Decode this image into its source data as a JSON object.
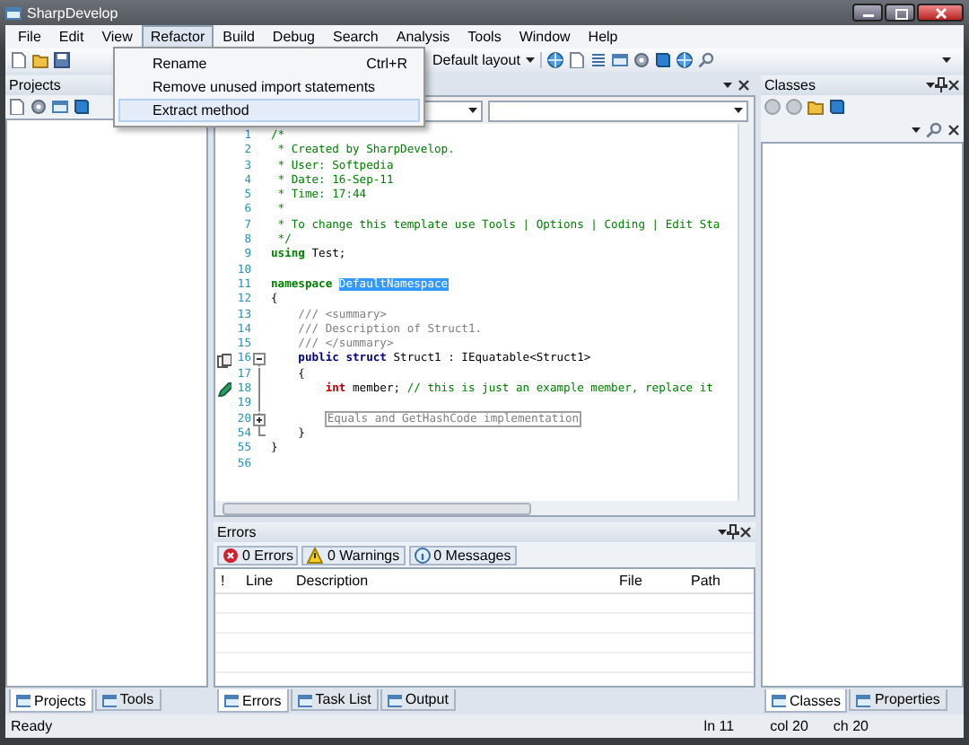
{
  "window": {
    "title": "SharpDevelop"
  },
  "menu": [
    {
      "label": "File",
      "selected": false
    },
    {
      "label": "Edit",
      "selected": false
    },
    {
      "label": "View",
      "selected": false
    },
    {
      "label": "Refactor",
      "selected": true
    },
    {
      "label": "Build",
      "selected": false
    },
    {
      "label": "Debug",
      "selected": false
    },
    {
      "label": "Search",
      "selected": false
    },
    {
      "label": "Analysis",
      "selected": false
    },
    {
      "label": "Tools",
      "selected": false
    },
    {
      "label": "Window",
      "selected": false
    },
    {
      "label": "Help",
      "selected": false
    }
  ],
  "dropdown": [
    {
      "label": "Rename",
      "shortcut": "Ctrl+R",
      "highlighted": false
    },
    {
      "label": "Remove unused import statements",
      "highlighted": false
    },
    {
      "label": "Extract method",
      "highlighted": true
    }
  ],
  "toolbar": {
    "layout": "Default layout"
  },
  "projects": {
    "title": "Projects",
    "tabs": [
      {
        "label": "Projects",
        "selected": true
      },
      {
        "label": "Tools",
        "selected": false
      }
    ]
  },
  "editor": {
    "lines": [
      {
        "number": "1",
        "segments": [
          {
            "kind": "comment",
            "text": "/*"
          }
        ]
      },
      {
        "number": "2",
        "segments": [
          {
            "kind": "comment",
            "text": " * Created by SharpDevelop."
          }
        ]
      },
      {
        "number": "3",
        "segments": [
          {
            "kind": "comment",
            "text": " * User: Softpedia"
          }
        ]
      },
      {
        "number": "4",
        "segments": [
          {
            "kind": "comment",
            "text": " * Date: 16-Sep-11"
          }
        ]
      },
      {
        "number": "5",
        "segments": [
          {
            "kind": "comment",
            "text": " * Time: 17:44"
          }
        ]
      },
      {
        "number": "6",
        "segments": [
          {
            "kind": "comment",
            "text": " *"
          }
        ]
      },
      {
        "number": "7",
        "segments": [
          {
            "kind": "comment",
            "text": " * To change this template use Tools | Options | Coding | Edit Sta"
          }
        ]
      },
      {
        "number": "8",
        "segments": [
          {
            "kind": "comment",
            "text": " */"
          }
        ]
      },
      {
        "number": "9",
        "segments": [
          {
            "kind": "keyword",
            "text": "using"
          },
          {
            "kind": "plain",
            "text": " Test;"
          }
        ]
      },
      {
        "number": "10"
      },
      {
        "number": "11",
        "segments": [
          {
            "kind": "keyword",
            "text": "namespace "
          },
          {
            "kind": "selection",
            "text": "DefaultNamespace"
          }
        ]
      },
      {
        "number": "12",
        "segments": [
          {
            "kind": "plain",
            "text": "{"
          }
        ]
      },
      {
        "number": "13",
        "segments": [
          {
            "kind": "doc",
            "text": "    /// <summary>"
          }
        ]
      },
      {
        "number": "14",
        "segments": [
          {
            "kind": "doc",
            "text": "    /// Description of Struct1."
          }
        ]
      },
      {
        "number": "15",
        "segments": [
          {
            "kind": "doc",
            "text": "    /// </summary>"
          }
        ]
      },
      {
        "number": "16",
        "expanded": true,
        "segments": [
          {
            "kind": "modifier",
            "text": "    public struct"
          },
          {
            "kind": "plain",
            "text": " Struct1 : IEquatable<Struct1>"
          }
        ],
        "children": [
          {
            "number": "17",
            "segments": [
              {
                "kind": "plain",
                "text": "    {"
              }
            ]
          },
          {
            "number": "18",
            "segments": [
              {
                "kind": "type",
                "text": "        int"
              },
              {
                "kind": "plain",
                "text": " member; "
              },
              {
                "kind": "comment",
                "text": "// this is just an example member, replace it"
              }
            ]
          },
          {
            "number": "19"
          },
          {
            "number": "20",
            "expanded": false,
            "segments": [
              {
                "kind": "folded",
                "text": "Equals and GetHashCode implementation"
              }
            ]
          },
          {
            "number": "54",
            "segments": [
              {
                "kind": "plain",
                "text": "    }"
              }
            ]
          }
        ]
      },
      {
        "number": "55",
        "segments": [
          {
            "kind": "plain",
            "text": "}"
          }
        ]
      },
      {
        "number": "56"
      }
    ]
  },
  "errors": {
    "title": "Errors",
    "filters": [
      "0 Errors",
      "0 Warnings",
      "0 Messages"
    ],
    "columns": [
      "!",
      "Line",
      "Description",
      "File",
      "Path"
    ],
    "tabs": [
      {
        "label": "Errors",
        "selected": true
      },
      {
        "label": "Task List",
        "selected": false
      },
      {
        "label": "Output",
        "selected": false
      }
    ]
  },
  "classes": {
    "title": "Classes",
    "tabs": [
      {
        "label": "Classes",
        "selected": true
      },
      {
        "label": "Properties",
        "selected": false
      }
    ]
  },
  "status_bar": {
    "message": "Ready",
    "line": "ln 11",
    "column": "col 20",
    "char": "ch 20"
  }
}
